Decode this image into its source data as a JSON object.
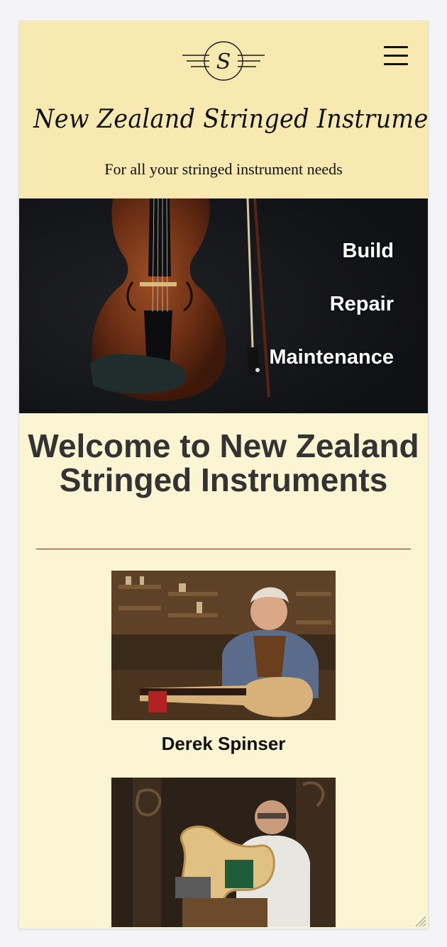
{
  "header": {
    "logo_letter": "S",
    "site_title": "New Zealand Stringed Instruments",
    "tagline": "For all your stringed instrument needs"
  },
  "hero": {
    "links": [
      "Build",
      "Repair",
      "Maintenance"
    ]
  },
  "main": {
    "welcome": "Welcome to New Zealand Stringed Instruments",
    "makers": [
      {
        "name": "Derek Spinser"
      },
      {
        "name": ""
      }
    ]
  },
  "colors": {
    "header_bg": "#f7e9b0",
    "content_bg": "#fbf5d4",
    "hero_bg": "#15161a",
    "divider": "#8a2e1c"
  },
  "icons": [
    "logo-icon",
    "hamburger-menu-icon",
    "resize-grip-icon"
  ]
}
